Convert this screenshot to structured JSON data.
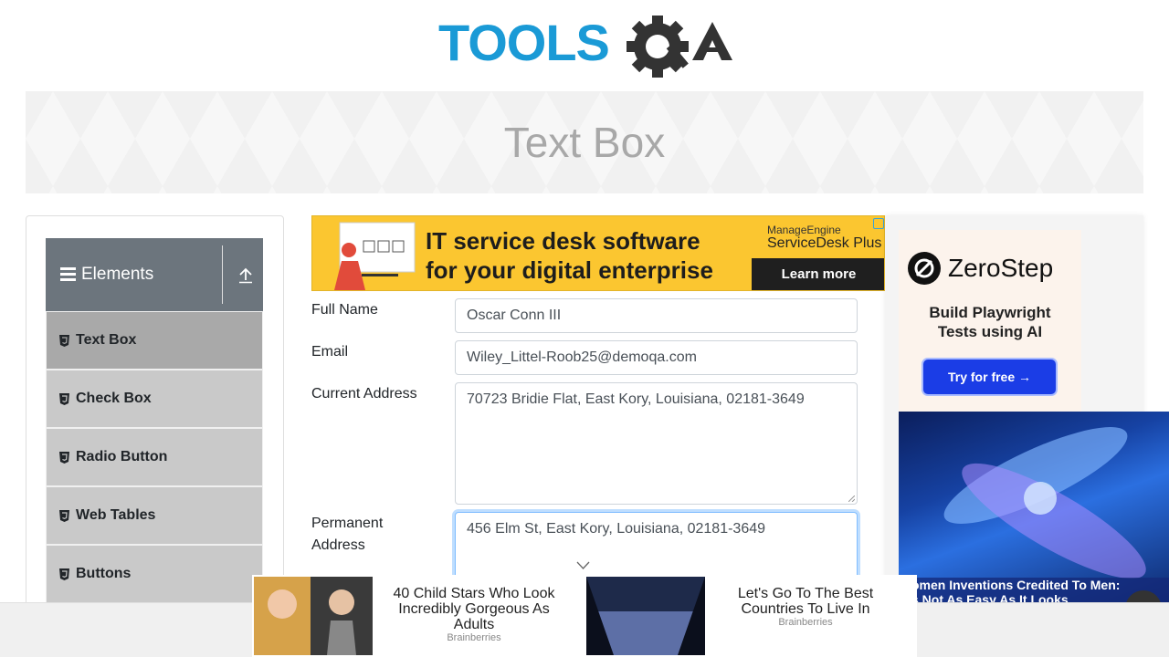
{
  "header": {
    "logo_text_part1": "TOOLS",
    "logo_text_part2": "QA"
  },
  "banner": {
    "title": "Text Box"
  },
  "sidebar": {
    "group_title": "Elements",
    "items": [
      {
        "label": "Text Box",
        "active": true
      },
      {
        "label": "Check Box",
        "active": false
      },
      {
        "label": "Radio Button",
        "active": false
      },
      {
        "label": "Web Tables",
        "active": false
      },
      {
        "label": "Buttons",
        "active": false
      }
    ]
  },
  "ad_top": {
    "headline_line1": "IT service desk software",
    "headline_line2": "for your digital enterprise",
    "brand_top": "ManageEngine",
    "brand_bottom": "ServiceDesk Plus",
    "cta": "Learn more"
  },
  "form": {
    "full_name_label": "Full Name",
    "full_name_value": "Oscar Conn III",
    "email_label": "Email",
    "email_value": "Wiley_Littel-Roob25@demoqa.com",
    "current_address_label": "Current Address",
    "current_address_value": "70723 Bridie Flat, East Kory, Louisiana, 02181-3649",
    "permanent_address_label_line1": "Permanent",
    "permanent_address_label_line2": "Address",
    "permanent_address_value": "456 Elm St, East Kory, Louisiana, 02181-3649"
  },
  "ad_right": {
    "brand": "ZeroStep",
    "tagline_line1": "Build Playwright",
    "tagline_line2": "Tests using AI",
    "cta": "Try for free →",
    "image_caption_line1": "omen Inventions Credited To Men:",
    "image_caption_line2": "s Not As Easy As It Looks"
  },
  "ad_bottom": {
    "item1_title": "40 Child Stars Who Look Incredibly Gorgeous As Adults",
    "item1_source": "Brainberries",
    "item2_title": "Let's Go To The Best Countries To Live In",
    "item2_source": "Brainberries"
  },
  "colors": {
    "logo_blue": "#1a9ad6",
    "logo_dark": "#333333",
    "sidebar_header": "#6c757d",
    "menu_item": "#c9c9c9",
    "menu_item_active": "#a9a9a9",
    "ad_yellow": "#fbc630",
    "zs_button": "#1b3de6"
  }
}
